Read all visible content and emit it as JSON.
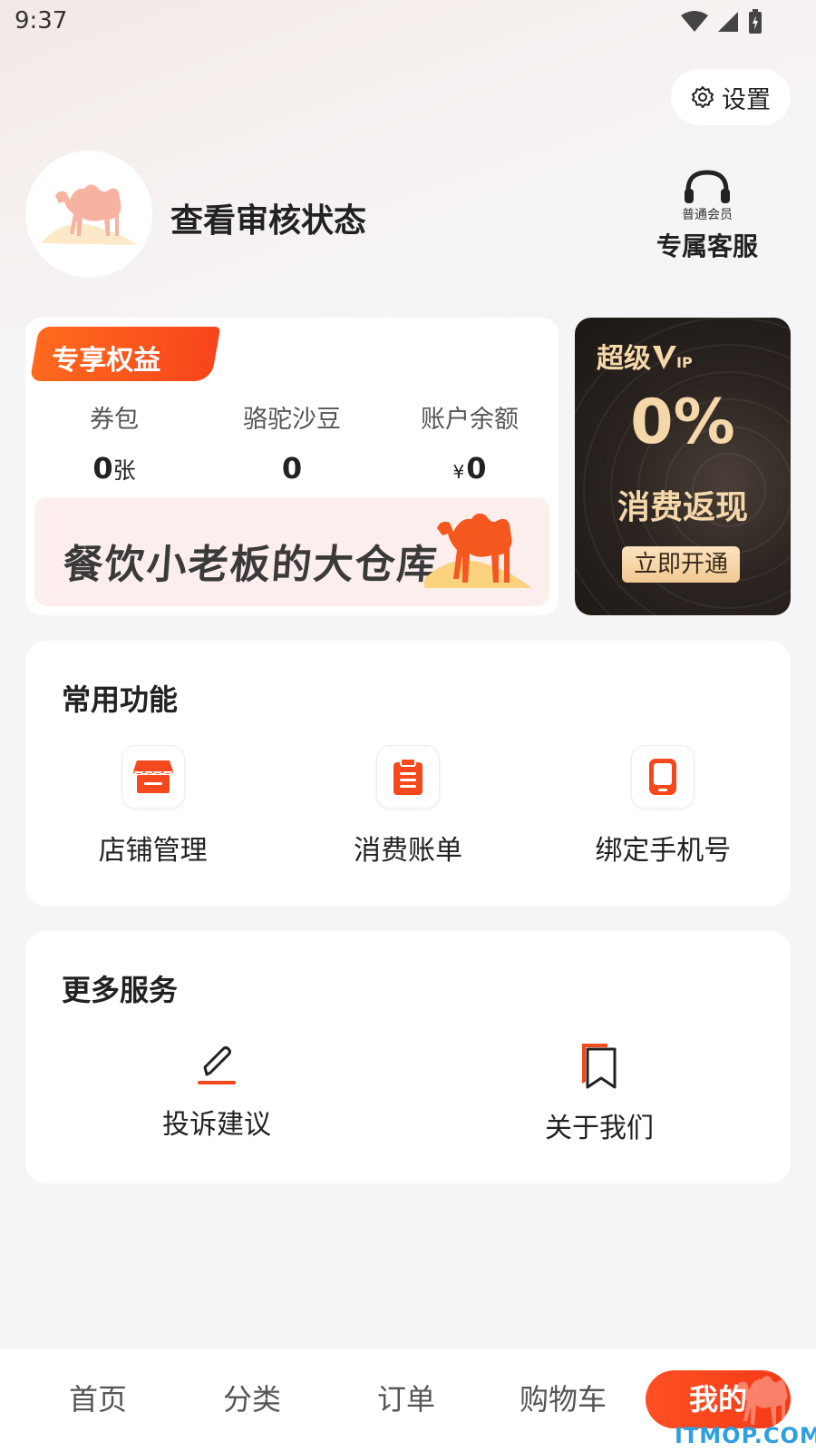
{
  "status_bar": {
    "time": "9:37"
  },
  "header": {
    "settings_label": "设置",
    "username": "查看审核状态",
    "service_level": "普通会员",
    "service_label": "专属客服"
  },
  "benefits": {
    "tag": "专享权益",
    "stats": [
      {
        "name": "券包",
        "value": "0",
        "unit": "张"
      },
      {
        "name": "骆驼沙豆",
        "value": "0"
      },
      {
        "name": "账户余额",
        "currency": "¥",
        "value": "0"
      }
    ],
    "banner_text": "餐饮小老板的大仓库"
  },
  "vip": {
    "title": "超级",
    "badge": "IP",
    "percent": "0%",
    "desc": "消费返现",
    "button": "立即开通"
  },
  "common_functions": {
    "title": "常用功能",
    "items": [
      {
        "label": "店铺管理",
        "icon": "store-icon"
      },
      {
        "label": "消费账单",
        "icon": "clipboard-icon"
      },
      {
        "label": "绑定手机号",
        "icon": "phone-icon"
      }
    ]
  },
  "more_services": {
    "title": "更多服务",
    "items": [
      {
        "label": "投诉建议",
        "icon": "pen-icon"
      },
      {
        "label": "关于我们",
        "icon": "bookmark-icon"
      }
    ]
  },
  "tabs": [
    {
      "label": "首页"
    },
    {
      "label": "分类"
    },
    {
      "label": "订单"
    },
    {
      "label": "购物车"
    },
    {
      "label": "我的",
      "active": true
    }
  ],
  "watermark": "ITMOP.COM",
  "colors": {
    "accent": "#f5461b",
    "vip_gold": "#f6d7a9",
    "vip_bg": "#2b2420"
  }
}
